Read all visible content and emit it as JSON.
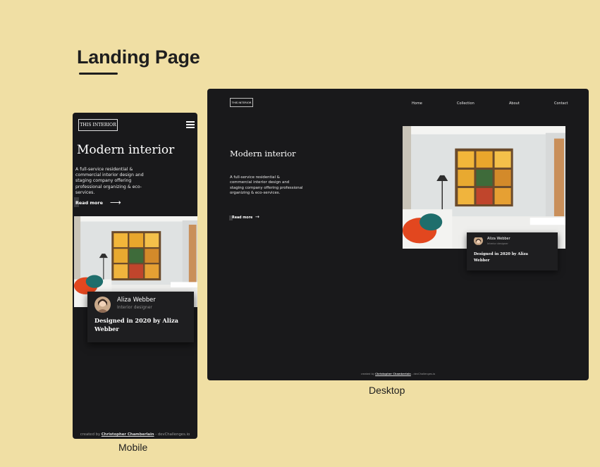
{
  "page": {
    "title": "Landing Page"
  },
  "labels": {
    "mobile": "Mobile",
    "desktop": "Desktop"
  },
  "site": {
    "logo": "THIS INTERIOR",
    "nav": [
      "Home",
      "Collection",
      "About",
      "Contact"
    ],
    "heading": "Modern interior",
    "description": "A full-service residential & commercial interior design and staging company offering professional organizing & eco-services.",
    "read_more": "Read more",
    "card": {
      "name": "Aliza Webber",
      "role": "Interior designer",
      "credit": "Designed in 2020 by Aliza Webber"
    },
    "footer": {
      "prefix": "created by",
      "author": "Christopher Chamberlain",
      "suffix": "- devChallenges.io"
    }
  },
  "colors": {
    "background": "#f0dfa4",
    "frame": "#19191b",
    "card": "#1e1e20",
    "accent_yellow": "#f2b63a"
  },
  "icons": [
    "hamburger-menu-icon",
    "arrow-right-icon",
    "avatar-image"
  ]
}
